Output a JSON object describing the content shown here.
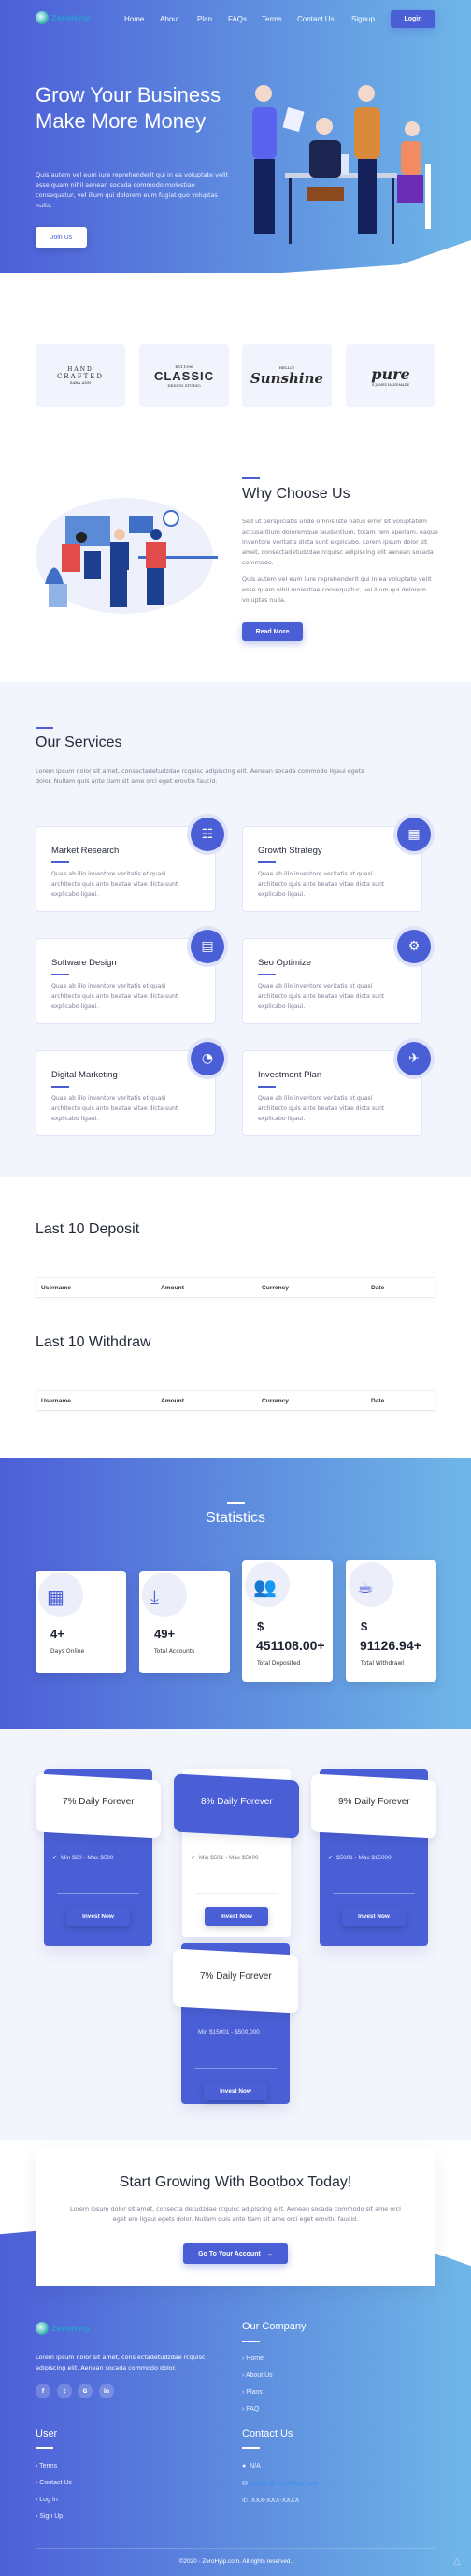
{
  "nav": {
    "brand": "ZeroHyip",
    "items": [
      "Home",
      "About",
      "Plan",
      "FAQs",
      "Terms",
      "Contact Us",
      "Signup"
    ],
    "login": "Login"
  },
  "hero": {
    "title": "Grow Your Business Make More Money",
    "text": "Quis autem vel eum iure reprehenderit qui in ea voluptate velit esse quam nihil aenean socada commodo molestiae consequatur, vel illum qui dolorem eum fugiat quo voluptas nulla.",
    "cta": "Join Us"
  },
  "logos": [
    {
      "top": "HAND",
      "mid": "CRAFTED",
      "bot": "SARA ANN"
    },
    {
      "top": "EST.1996",
      "mid": "CLASSIC",
      "bot": "DESIGN STUDIO"
    },
    {
      "top": "HELLO!",
      "mid": "Sunshine",
      "bot": ""
    },
    {
      "top": "",
      "mid": "pure",
      "bot": "S.JAMES HANDMADE"
    }
  ],
  "why": {
    "title": "Why Choose Us",
    "p1": "Sed ut perspiciatis unde omnis iste natus error sit voluptatem accusantium doloremque laudantium, totam rem aperiam, eaque inventore veritatis dicta sunt explicabo. Lorem ipsum dolor sit amet, consectadetudzdae rcquisc adipiscing elit aenean socada commodo.",
    "p2": "Quis autem vel eum iure reprehenderit qui in ea voluptate velit esse quam nihil molestiae consequatur, vel illum qui dolorem voluptas nulla.",
    "button": "Read More"
  },
  "services": {
    "title": "Our Services",
    "text": "Lorem ipsum dolor sit amet, consectadetudzdae rcquisc adipiscing elit. Aenean socada commodo ligaui egets dolor. Nullam quis ante tiam sit ame orci eget erovtiu faucid.",
    "items": [
      {
        "title": "Market Research",
        "text": "Quae ab illo inventore veritatis et quasi architecto quis ante beatae vitae dicta sunt explicabo ligaui.",
        "icon": "meeting-icon"
      },
      {
        "title": "Growth Strategy",
        "text": "Quae ab illo inventore veritatis et quasi architecto quis ante beatae vitae dicta sunt explicabo ligaui.",
        "icon": "strategy-icon"
      },
      {
        "title": "Software Design",
        "text": "Quae ab illo inventore veritatis et quasi architecto quis ante beatae vitae dicta sunt explicabo ligaui.",
        "icon": "design-icon"
      },
      {
        "title": "Seo Optimize",
        "text": "Quae ab illo inventore veritatis et quasi architecto quis ante beatae vitae dicta sunt explicabo ligaui.",
        "icon": "seo-icon"
      },
      {
        "title": "Digital Marketing",
        "text": "Quae ab illo inventore veritatis et quasi architecto quis ante beatae vitae dicta sunt explicabo ligaui.",
        "icon": "marketing-icon"
      },
      {
        "title": "Investment Plan",
        "text": "Quae ab illo inventore veritatis et quasi architecto quis ante beatae vitae dicta sunt explicabo ligaui.",
        "icon": "handshake-growth-icon"
      }
    ]
  },
  "deposit": {
    "title": "Last 10 Deposit",
    "columns": [
      "Username",
      "Amount",
      "Currency",
      "Date"
    ]
  },
  "withdraw": {
    "title": "Last 10 Withdraw",
    "columns": [
      "Username",
      "Amount",
      "Currency",
      "Date"
    ]
  },
  "stats": {
    "title": "Statistics",
    "items": [
      {
        "value": "4+",
        "label": "Days Online",
        "icon": "document-icon"
      },
      {
        "value": "49+",
        "label": "Total Accounts",
        "icon": "download-icon"
      },
      {
        "prefix": "$",
        "value": "451108.00+",
        "label": "Total Deposited",
        "icon": "users-icon"
      },
      {
        "prefix": "$",
        "value": "91126.94+",
        "label": "Total Withdrawl",
        "icon": "cup-icon"
      }
    ]
  },
  "plans": [
    {
      "title": "7% Daily Forever",
      "feature": "Min $20 - Max $500",
      "button": "Invest Now"
    },
    {
      "title": "8% Daily Forever",
      "feature": "Min $501 - Max $5000",
      "button": "Invest Now"
    },
    {
      "title": "9% Daily Forever",
      "feature": "$5001 - Max $15000",
      "button": "Invest Now"
    },
    {
      "title": "7% Daily Forever",
      "feature": "Min $15001 - $500,000",
      "button": "Invest Now"
    }
  ],
  "cta": {
    "title": "Start Growing With Bootbox Today!",
    "text": "Lorem ipsum dolor sit amet, consecta detudzdae rcquisc adipiscing elit. Aenean socada commodo sit ame orci eget ero ligaui egets dolor. Nullam quis ante tiam sit ame orci eget erovtiu faucid.",
    "button": "Go To Your Account",
    "arrow": "→"
  },
  "footer": {
    "about": "Lorem ipsum dolor sit amet, cons ectadetudzdae rcquisc adipiscing elit. Aenean socada commodo dolor.",
    "social": [
      "f",
      "t",
      "G",
      "in"
    ],
    "company": {
      "title": "Our Company",
      "links": [
        "Home",
        "About Us",
        "Plans",
        "FAQ"
      ]
    },
    "user": {
      "title": "User",
      "links": [
        "Terms",
        "Contact Us",
        "Log In",
        "Sign Up"
      ]
    },
    "contact": {
      "title": "Contact Us",
      "address": "N/A",
      "email": "admin@ ZeroHyip.com",
      "phone": "XXX-XXX-XXXX"
    },
    "copyright": "©2020 - ZeroHyip.com. All rights reserved."
  },
  "colors": {
    "primary": "#4a5fd6",
    "gradient_end": "#6fb7e8",
    "section_bg": "#f3f5fd"
  }
}
